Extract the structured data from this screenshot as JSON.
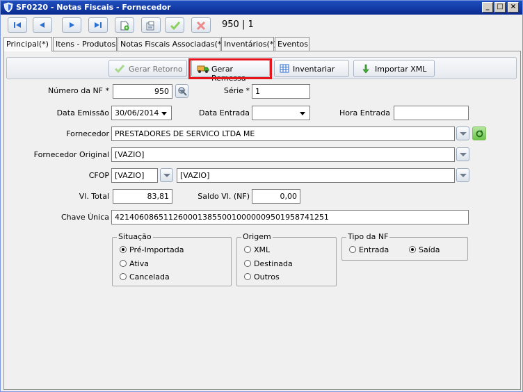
{
  "window": {
    "title": "SF0220 - Notas Fiscais - Fornecedor",
    "minimize": "_",
    "restore": "□",
    "close": "×"
  },
  "toolbar": {
    "record_count": "950 | 1",
    "buttons": [
      "first-record-icon",
      "prev-record-icon",
      "next-record-icon",
      "last-record-icon",
      "new-record-icon",
      "edit-record-icon",
      "confirm-icon",
      "cancel-icon"
    ]
  },
  "tabs": [
    "Principal(*)",
    "Itens - Produtos",
    "Notas Fiscais Associadas(*)",
    "Inventários(*)",
    "Eventos"
  ],
  "actions": {
    "gerar_retorno": "Gerar Retorno",
    "gerar_remessa": "Gerar Remessa",
    "inventariar": "Inventariar",
    "importar_xml": "Importar XML"
  },
  "form": {
    "numero_nf_label": "Número da NF *",
    "numero_nf": "950",
    "serie_label": "Série *",
    "serie": "1",
    "data_emissao_label": "Data Emissão",
    "data_emissao": "30/06/2014",
    "data_entrada_label": "Data Entrada",
    "data_entrada": "",
    "hora_entrada_label": "Hora Entrada",
    "hora_entrada": "",
    "fornecedor_label": "Fornecedor",
    "fornecedor": "PRESTADORES DE SERVICO LTDA ME",
    "fornecedor_original_label": "Fornecedor Original",
    "fornecedor_original": "[VAZIO]",
    "cfop_label": "CFOP",
    "cfop_code": "[VAZIO]",
    "cfop_desc": "[VAZIO]",
    "vl_total_label": "Vl. Total",
    "vl_total": "83,81",
    "saldo_label": "Saldo Vl. (NF)",
    "saldo": "0,00",
    "chave_label": "Chave Única",
    "chave": "42140608651126000138550010000009501958741251"
  },
  "situacao": {
    "title": "Situação",
    "options": [
      "Pré-Importada",
      "Ativa",
      "Cancelada"
    ],
    "selected": "Pré-Importada"
  },
  "origem": {
    "title": "Origem",
    "options": [
      "XML",
      "Destinada",
      "Outros"
    ],
    "selected": ""
  },
  "tipo_nf": {
    "title": "Tipo da NF",
    "options": [
      "Entrada",
      "Saída"
    ],
    "selected": "Saída"
  },
  "colors": {
    "title_bar": "#0a2a8f",
    "highlight_box": "#e8141c",
    "accent_green": "#3fae2f",
    "accent_red": "#e04c4c"
  }
}
